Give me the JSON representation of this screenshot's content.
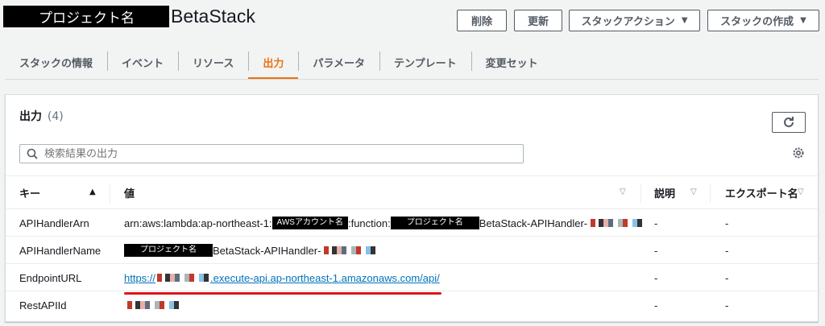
{
  "header": {
    "project_mask": "プロジェクト名",
    "stack_name": "BetaStack",
    "buttons": {
      "delete": "削除",
      "update": "更新",
      "stack_actions": "スタックアクション",
      "create_stack": "スタックの作成"
    }
  },
  "tabs": [
    "スタックの情報",
    "イベント",
    "リソース",
    "出力",
    "パラメータ",
    "テンプレート",
    "変更セット"
  ],
  "panel": {
    "title": "出力",
    "count": "(4)",
    "search_placeholder": "検索結果の出力"
  },
  "table": {
    "columns": [
      "キー",
      "値",
      "説明",
      "エクスポート名"
    ],
    "rows": [
      {
        "key": "APIHandlerArn",
        "value_prefix": "arn:aws:lambda:ap-northeast-1:",
        "account_mask": "AWSアカウント名",
        "value_mid": ":function:",
        "project_mask": "プロジェクト名",
        "value_suffix": "BetaStack-APIHandler-",
        "description": "-",
        "export": "-"
      },
      {
        "key": "APIHandlerName",
        "project_mask": "プロジェクト名",
        "value_suffix": "BetaStack-APIHandler-",
        "description": "-",
        "export": "-"
      },
      {
        "key": "EndpointURL",
        "value_prefix": "https://",
        "value_suffix": ".execute-api.ap-northeast-1.amazonaws.com/api/",
        "description": "-",
        "export": "-"
      },
      {
        "key": "RestAPIId",
        "description": "-",
        "export": "-"
      }
    ]
  },
  "colors": {
    "accent": "#ec7211",
    "link": "#0073bb",
    "annotation": "#e3131a"
  }
}
